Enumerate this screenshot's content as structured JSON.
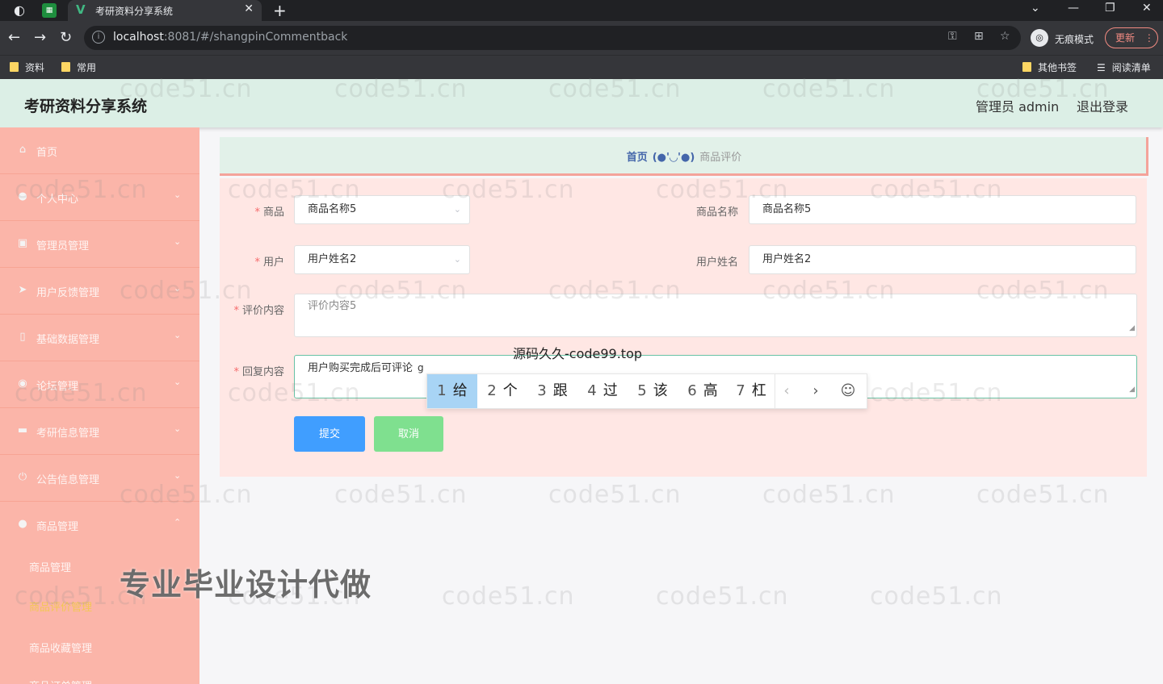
{
  "browser": {
    "tab_title": "考研资料分享系统",
    "url_host": "localhost",
    "url_rest": ":8081/#/shangpinCommentback",
    "incognito_label": "无痕模式",
    "update_label": "更新",
    "bookmarks": [
      "资料",
      "常用"
    ],
    "bookmarks_right": [
      "其他书签",
      "阅读清单"
    ]
  },
  "header": {
    "brand": "考研资料分享系统",
    "user": "管理员 admin",
    "logout": "退出登录"
  },
  "sidebar": {
    "items": [
      {
        "label": "首页",
        "icon": "home-icon"
      },
      {
        "label": "个人中心",
        "icon": "user-icon"
      },
      {
        "label": "管理员管理",
        "icon": "lock-icon"
      },
      {
        "label": "用户反馈管理",
        "icon": "send-icon"
      },
      {
        "label": "基础数据管理",
        "icon": "mic-icon"
      },
      {
        "label": "论坛管理",
        "icon": "marker-icon"
      },
      {
        "label": "考研信息管理",
        "icon": "chat-icon"
      },
      {
        "label": "公告信息管理",
        "icon": "power-icon"
      },
      {
        "label": "商品管理",
        "icon": "user-icon"
      }
    ],
    "sub_items": [
      "商品管理",
      "商品评价管理",
      "商品收藏管理",
      "商品订单管理"
    ]
  },
  "breadcrumb": {
    "home": "首页",
    "separator": "(●'◡'●)",
    "current": "商品评价"
  },
  "form": {
    "product_label": "商品",
    "product_value": "商品名称5",
    "product_name_label": "商品名称",
    "product_name_value": "商品名称5",
    "user_label": "用户",
    "user_value": "用户姓名2",
    "user_name_label": "用户姓名",
    "user_name_value": "用户姓名2",
    "comment_label": "评价内容",
    "comment_value": "评价内容5",
    "reply_label": "回复内容",
    "reply_value": "用户购买完成后可评论",
    "reply_typing": "g",
    "submit": "提交",
    "cancel": "取消"
  },
  "ime": {
    "title": "源码久久-code99.top",
    "candidates": [
      {
        "n": "1",
        "c": "给"
      },
      {
        "n": "2",
        "c": "个"
      },
      {
        "n": "3",
        "c": "跟"
      },
      {
        "n": "4",
        "c": "过"
      },
      {
        "n": "5",
        "c": "该"
      },
      {
        "n": "6",
        "c": "高"
      },
      {
        "n": "7",
        "c": "杠"
      }
    ],
    "prev": "‹",
    "next": "›",
    "emoji": "☺"
  },
  "watermark": "code51.cn",
  "promo": "专业毕业设计代做"
}
